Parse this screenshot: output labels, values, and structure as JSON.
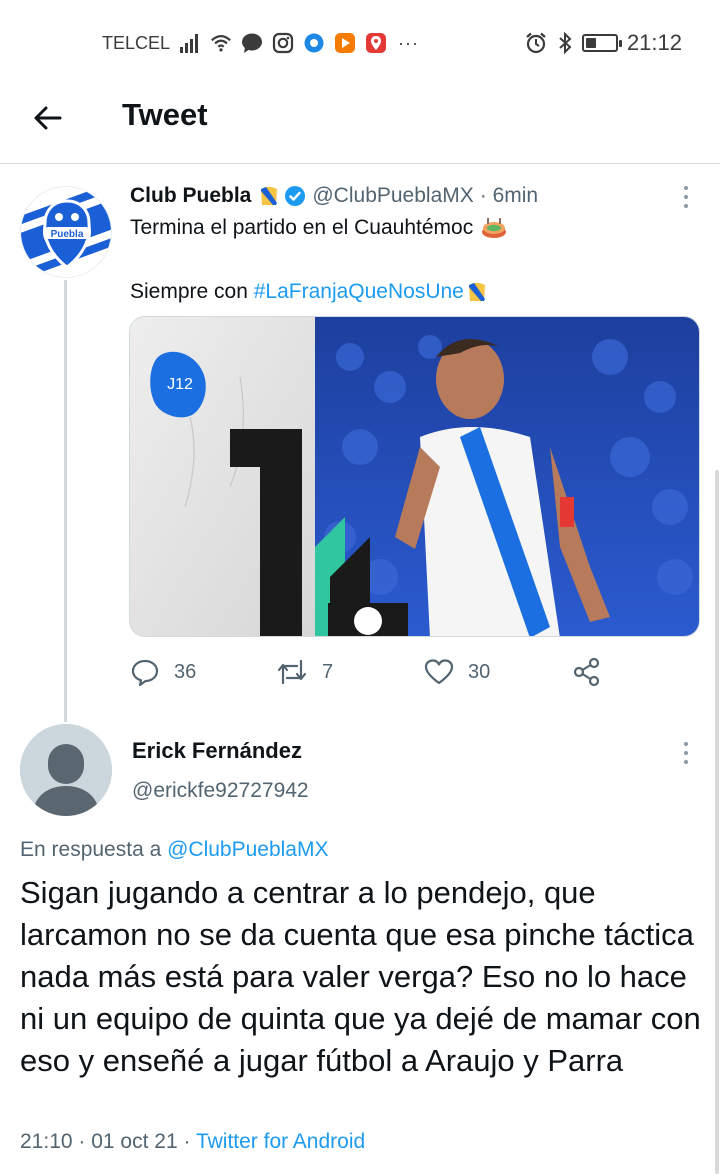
{
  "status_bar": {
    "carrier": "TELCEL",
    "more_indicator": "···",
    "time": "21:12",
    "battery_level": 0.35,
    "icons": [
      "signal-icon",
      "wifi-icon",
      "chat-bubble-icon",
      "instagram-icon",
      "messenger-icon",
      "media-app-icon",
      "maps-icon",
      "alarm-icon",
      "bluetooth-icon",
      "battery-icon"
    ]
  },
  "header": {
    "title": "Tweet"
  },
  "tweet": {
    "author_name": "Club Puebla",
    "author_handle": "@ClubPueblaMX",
    "time_ago": "· 6min",
    "line1": "Termina el partido en el Cuauhtémoc",
    "line2_prefix": "Siempre con ",
    "hashtag": "#LaFranjaQueNosUne",
    "media_badge": "J12",
    "stats": {
      "replies": "36",
      "retweets": "7",
      "likes": "30"
    },
    "colors": {
      "brand_blue": "#1b5fd6",
      "link": "#1d9bf0"
    }
  },
  "reply": {
    "author_name": "Erick Fernández",
    "author_handle": "@erickfe92727942",
    "in_reply_prefix": "En respuesta a ",
    "in_reply_mention": "@ClubPueblaMX",
    "body": "Sigan jugando a centrar a lo pendejo, que larcamon no se da cuenta que esa pinche táctica nada más está para valer verga? Eso no lo hace ni un equipo de quinta que ya dejé de mamar con eso y enseñé a jugar fútbol a Araujo y Parra",
    "time": "21:10",
    "date": "01 oct 21",
    "source": "Twitter for Android"
  }
}
